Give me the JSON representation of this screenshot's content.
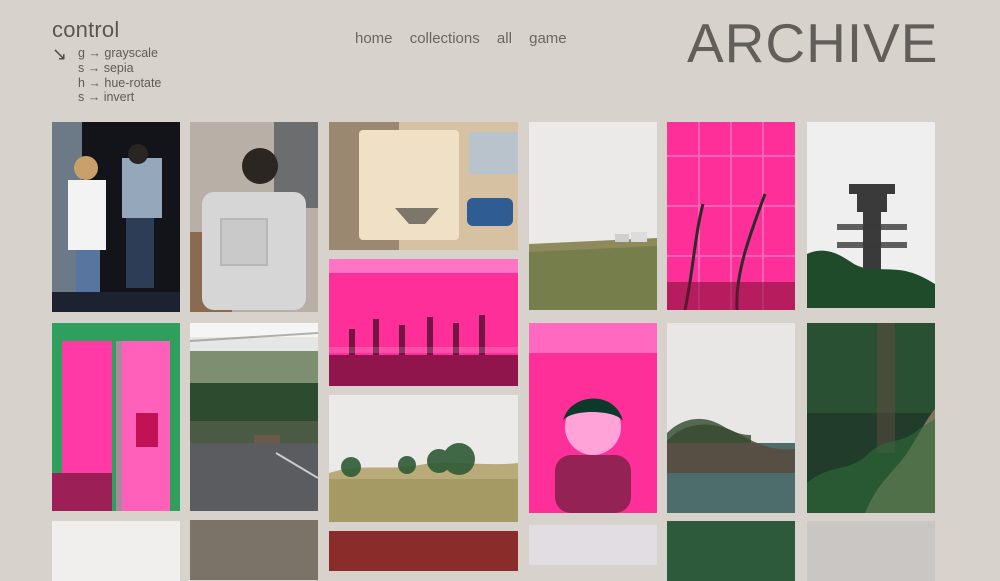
{
  "control": {
    "title": "control",
    "arrow": "↘",
    "shortcuts": [
      "g → grayscale",
      "s → sepia",
      "h → hue-rotate",
      "s → invert"
    ]
  },
  "nav": {
    "items": [
      "home",
      "collections",
      "all",
      "game"
    ]
  },
  "brand": "ARCHIVE",
  "colors": {
    "background": "#d7d2cc",
    "text": "#5f5b57",
    "magenta": "#ff2f9a",
    "fog": "#e8e6e4"
  }
}
